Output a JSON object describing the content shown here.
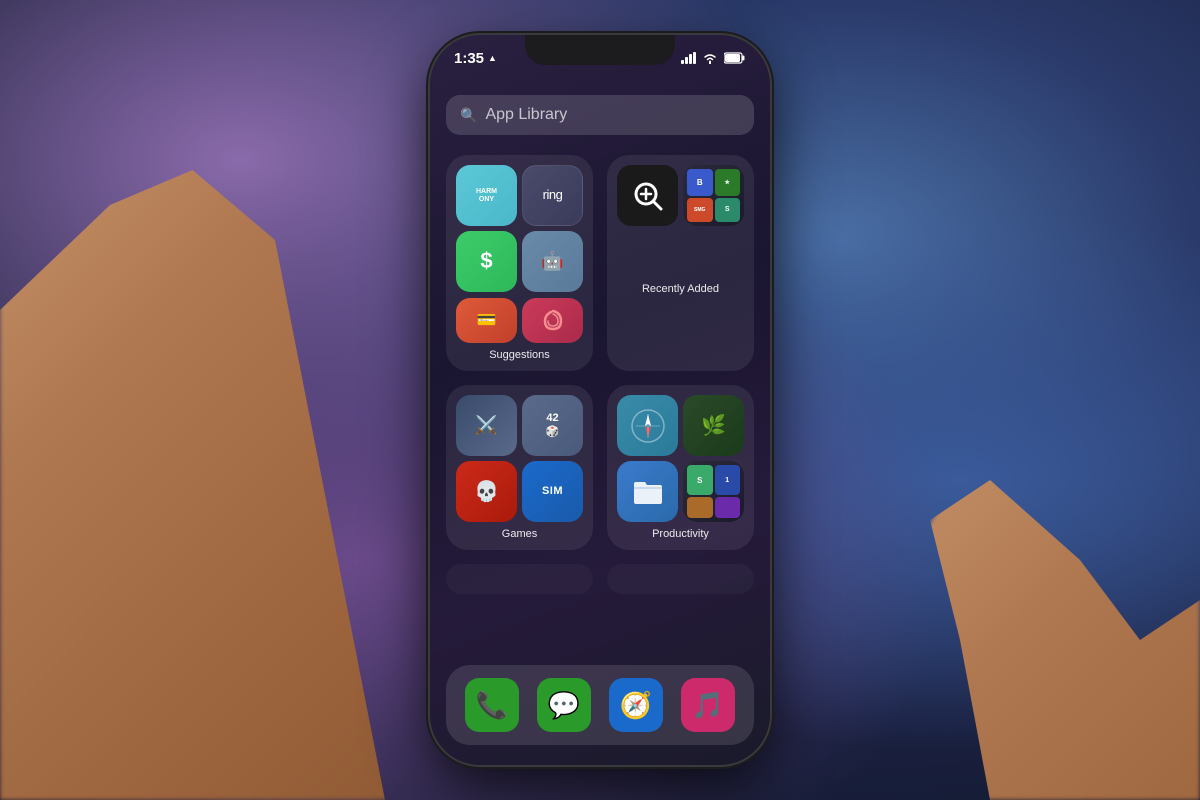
{
  "background": {
    "color_top": "#2a3060",
    "color_bottom": "#1a2040"
  },
  "phone": {
    "status_bar": {
      "time": "1:35",
      "location_icon": "▲",
      "signal": "▐▐▐",
      "wifi": "wifi",
      "battery": "🔋"
    },
    "search": {
      "placeholder": "App Library",
      "icon": "🔍"
    },
    "folders": [
      {
        "id": "suggestions",
        "label": "Suggestions",
        "apps": [
          {
            "name": "Harmony",
            "short": "HARM\nONY",
            "color_class": "app-harmony"
          },
          {
            "name": "Ring",
            "short": "ring",
            "color_class": "app-ring"
          },
          {
            "name": "Cash App",
            "short": "$",
            "color_class": "app-cash"
          },
          {
            "name": "AI App",
            "short": "🤖",
            "color_class": "app-ai"
          }
        ],
        "bottom_apps": [
          {
            "name": "Wallet",
            "short": "💳",
            "color_class": "app-wallet"
          },
          {
            "name": "Nova",
            "short": "🌀",
            "color_class": "app-nova"
          }
        ]
      },
      {
        "id": "recently-added",
        "label": "Recently Added",
        "apps": [
          {
            "name": "Loupe",
            "short": "🔍+",
            "color_class": "app-loupe"
          },
          {
            "name": "SMG",
            "short": "B\nSMG",
            "color_class": "app-smg"
          }
        ],
        "bottom_apps": []
      },
      {
        "id": "games",
        "label": "Games",
        "apps": [
          {
            "name": "Final Fantasy",
            "short": "⚔️",
            "color_class": "app-final"
          },
          {
            "name": "Dice App",
            "short": "🎲",
            "color_class": "app-dice"
          },
          {
            "name": "Skulls",
            "short": "💀",
            "color_class": "app-skulls"
          },
          {
            "name": "Sim",
            "short": "SIM",
            "color_class": "app-sim"
          }
        ]
      },
      {
        "id": "productivity",
        "label": "Productivity",
        "apps": [
          {
            "name": "Safari",
            "short": "🧭",
            "color_class": "app-safari"
          },
          {
            "name": "Robinhood",
            "short": "🌿",
            "color_class": "app-robinhood"
          },
          {
            "name": "Files",
            "short": "📁",
            "color_class": "app-files"
          },
          {
            "name": "Multi",
            "short": "S\n1",
            "color_class": "app-multi"
          }
        ]
      }
    ],
    "dock_apps": [
      {
        "name": "Phone",
        "emoji": "📞",
        "bg": "#2a7a2a"
      },
      {
        "name": "Messages",
        "emoji": "💬",
        "bg": "#2a7a2a"
      },
      {
        "name": "Safari",
        "emoji": "🧭",
        "bg": "#1a5aaa"
      },
      {
        "name": "Music",
        "emoji": "🎵",
        "bg": "#cc2a6a"
      }
    ]
  }
}
